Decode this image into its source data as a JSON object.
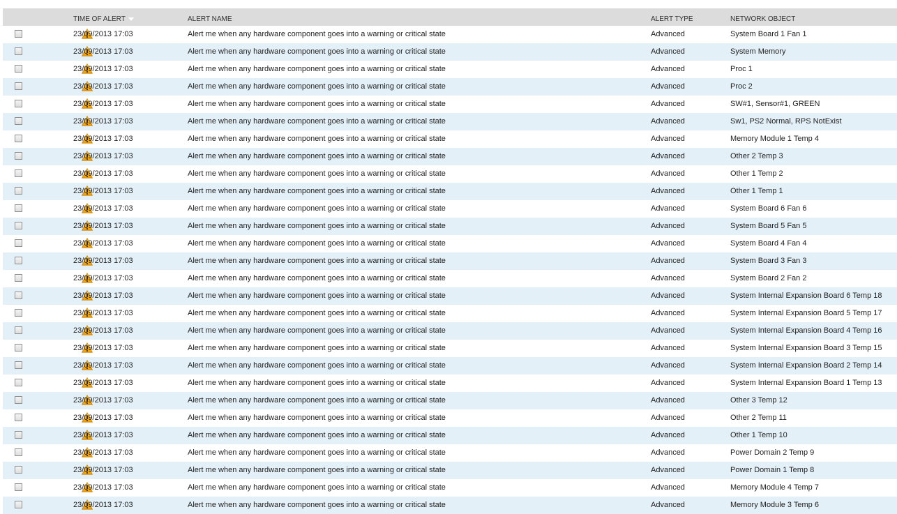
{
  "colors": {
    "header_bg": "#dcdcdc",
    "row_alt_bg": "#e4f0f7",
    "row_bg": "#ffffff",
    "warning_icon": "#f5a800"
  },
  "table": {
    "columns": {
      "checkbox": "",
      "icon": "",
      "time": "TIME OF ALERT",
      "name": "ALERT NAME",
      "type": "ALERT TYPE",
      "object": "NETWORK OBJECT"
    },
    "sort_column": "time",
    "sort_icon": "sort-descending-icon",
    "row_icon": "warning-icon",
    "rows": [
      {
        "time": "23/09/2013 17:03",
        "name": "Alert me when any hardware component goes into a warning or critical state",
        "type": "Advanced",
        "object": "System Board 1 Fan 1"
      },
      {
        "time": "23/09/2013 17:03",
        "name": "Alert me when any hardware component goes into a warning or critical state",
        "type": "Advanced",
        "object": "System Memory"
      },
      {
        "time": "23/09/2013 17:03",
        "name": "Alert me when any hardware component goes into a warning or critical state",
        "type": "Advanced",
        "object": "Proc 1"
      },
      {
        "time": "23/09/2013 17:03",
        "name": "Alert me when any hardware component goes into a warning or critical state",
        "type": "Advanced",
        "object": "Proc 2"
      },
      {
        "time": "23/09/2013 17:03",
        "name": "Alert me when any hardware component goes into a warning or critical state",
        "type": "Advanced",
        "object": "SW#1, Sensor#1, GREEN"
      },
      {
        "time": "23/09/2013 17:03",
        "name": "Alert me when any hardware component goes into a warning or critical state",
        "type": "Advanced",
        "object": "Sw1, PS2 Normal, RPS NotExist"
      },
      {
        "time": "23/09/2013 17:03",
        "name": "Alert me when any hardware component goes into a warning or critical state",
        "type": "Advanced",
        "object": "Memory Module 1 Temp 4"
      },
      {
        "time": "23/09/2013 17:03",
        "name": "Alert me when any hardware component goes into a warning or critical state",
        "type": "Advanced",
        "object": "Other 2 Temp 3"
      },
      {
        "time": "23/09/2013 17:03",
        "name": "Alert me when any hardware component goes into a warning or critical state",
        "type": "Advanced",
        "object": "Other 1 Temp 2"
      },
      {
        "time": "23/09/2013 17:03",
        "name": "Alert me when any hardware component goes into a warning or critical state",
        "type": "Advanced",
        "object": "Other 1 Temp 1"
      },
      {
        "time": "23/09/2013 17:03",
        "name": "Alert me when any hardware component goes into a warning or critical state",
        "type": "Advanced",
        "object": "System Board 6 Fan 6"
      },
      {
        "time": "23/09/2013 17:03",
        "name": "Alert me when any hardware component goes into a warning or critical state",
        "type": "Advanced",
        "object": "System Board 5 Fan 5"
      },
      {
        "time": "23/09/2013 17:03",
        "name": "Alert me when any hardware component goes into a warning or critical state",
        "type": "Advanced",
        "object": "System Board 4 Fan 4"
      },
      {
        "time": "23/09/2013 17:03",
        "name": "Alert me when any hardware component goes into a warning or critical state",
        "type": "Advanced",
        "object": "System Board 3 Fan 3"
      },
      {
        "time": "23/09/2013 17:03",
        "name": "Alert me when any hardware component goes into a warning or critical state",
        "type": "Advanced",
        "object": "System Board 2 Fan 2"
      },
      {
        "time": "23/09/2013 17:03",
        "name": "Alert me when any hardware component goes into a warning or critical state",
        "type": "Advanced",
        "object": "System Internal Expansion Board 6 Temp 18"
      },
      {
        "time": "23/09/2013 17:03",
        "name": "Alert me when any hardware component goes into a warning or critical state",
        "type": "Advanced",
        "object": "System Internal Expansion Board 5 Temp 17"
      },
      {
        "time": "23/09/2013 17:03",
        "name": "Alert me when any hardware component goes into a warning or critical state",
        "type": "Advanced",
        "object": "System Internal Expansion Board 4 Temp 16"
      },
      {
        "time": "23/09/2013 17:03",
        "name": "Alert me when any hardware component goes into a warning or critical state",
        "type": "Advanced",
        "object": "System Internal Expansion Board 3 Temp 15"
      },
      {
        "time": "23/09/2013 17:03",
        "name": "Alert me when any hardware component goes into a warning or critical state",
        "type": "Advanced",
        "object": "System Internal Expansion Board 2 Temp 14"
      },
      {
        "time": "23/09/2013 17:03",
        "name": "Alert me when any hardware component goes into a warning or critical state",
        "type": "Advanced",
        "object": "System Internal Expansion Board 1 Temp 13"
      },
      {
        "time": "23/09/2013 17:03",
        "name": "Alert me when any hardware component goes into a warning or critical state",
        "type": "Advanced",
        "object": "Other 3 Temp 12"
      },
      {
        "time": "23/09/2013 17:03",
        "name": "Alert me when any hardware component goes into a warning or critical state",
        "type": "Advanced",
        "object": "Other 2 Temp 11"
      },
      {
        "time": "23/09/2013 17:03",
        "name": "Alert me when any hardware component goes into a warning or critical state",
        "type": "Advanced",
        "object": "Other 1 Temp 10"
      },
      {
        "time": "23/09/2013 17:03",
        "name": "Alert me when any hardware component goes into a warning or critical state",
        "type": "Advanced",
        "object": "Power Domain 2 Temp 9"
      },
      {
        "time": "23/09/2013 17:03",
        "name": "Alert me when any hardware component goes into a warning or critical state",
        "type": "Advanced",
        "object": "Power Domain 1 Temp 8"
      },
      {
        "time": "23/09/2013 17:03",
        "name": "Alert me when any hardware component goes into a warning or critical state",
        "type": "Advanced",
        "object": "Memory Module 4 Temp 7"
      },
      {
        "time": "23/09/2013 17:03",
        "name": "Alert me when any hardware component goes into a warning or critical state",
        "type": "Advanced",
        "object": "Memory Module 3 Temp 6"
      }
    ]
  }
}
